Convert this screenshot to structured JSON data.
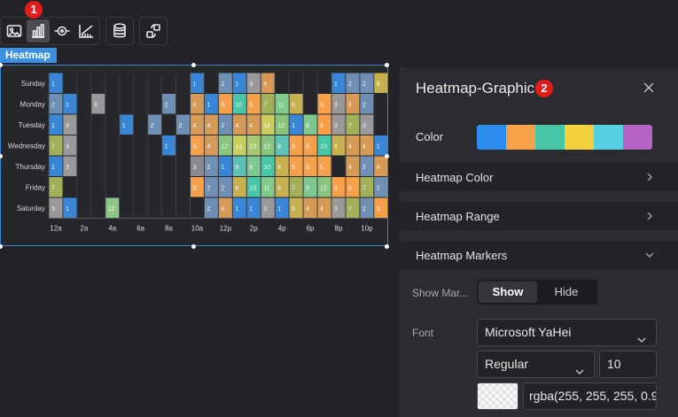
{
  "toolbar": {
    "buttons": [
      {
        "icon": "image-icon"
      },
      {
        "icon": "bar-chart-icon",
        "active": true
      },
      {
        "icon": "marker-icon"
      },
      {
        "icon": "axis-icon"
      },
      {
        "icon": "database-icon"
      },
      {
        "icon": "interaction-icon"
      }
    ],
    "badge_1": "1"
  },
  "widget_tag": "Heatmap",
  "panel": {
    "title": "Heatmap-Graphic",
    "badge_2": "2",
    "color_label": "Color",
    "palette": [
      "#2d8cf0",
      "#f9a24a",
      "#49c6a8",
      "#f4d03f",
      "#56cfe1",
      "#b564c6"
    ],
    "sections": {
      "heatmap_color": "Heatmap Color",
      "heatmap_range": "Heatmap Range",
      "heatmap_markers": "Heatmap Markers"
    },
    "show_markers_label": "Show Mar...",
    "show_label": "Show",
    "hide_label": "Hide",
    "font_label": "Font",
    "font_family": "Microsoft YaHei",
    "font_weight": "Regular",
    "font_size": "10",
    "font_color": "rgba(255, 255, 255, 0.9"
  },
  "chart_data": {
    "type": "heatmap",
    "y_categories": [
      "Sunday",
      "Monday",
      "Tuesday",
      "Wednesday",
      "Thursday",
      "Friday",
      "Saturday"
    ],
    "x_tick_labels": [
      "12a",
      "2a",
      "4a",
      "6a",
      "8a",
      "10a",
      "12p",
      "2p",
      "4p",
      "6p",
      "8p",
      "10p"
    ],
    "hours": 24,
    "cells": [
      [
        0,
        0,
        1
      ],
      [
        0,
        10,
        1
      ],
      [
        0,
        12,
        2
      ],
      [
        0,
        13,
        1
      ],
      [
        0,
        14,
        3
      ],
      [
        0,
        15,
        4
      ],
      [
        0,
        20,
        1
      ],
      [
        0,
        21,
        2
      ],
      [
        0,
        22,
        2
      ],
      [
        0,
        23,
        6
      ],
      [
        1,
        0,
        2
      ],
      [
        1,
        1,
        1
      ],
      [
        1,
        3,
        3
      ],
      [
        1,
        8,
        2
      ],
      [
        1,
        10,
        4
      ],
      [
        1,
        11,
        1
      ],
      [
        1,
        12,
        5
      ],
      [
        1,
        13,
        10
      ],
      [
        1,
        14,
        5
      ],
      [
        1,
        15,
        7
      ],
      [
        1,
        16,
        11
      ],
      [
        1,
        17,
        6
      ],
      [
        1,
        19,
        5
      ],
      [
        1,
        20,
        3
      ],
      [
        1,
        21,
        4
      ],
      [
        1,
        22,
        2
      ],
      [
        2,
        0,
        1
      ],
      [
        2,
        1,
        3
      ],
      [
        2,
        5,
        1
      ],
      [
        2,
        7,
        2
      ],
      [
        2,
        9,
        2
      ],
      [
        2,
        10,
        4
      ],
      [
        2,
        11,
        4
      ],
      [
        2,
        12,
        2
      ],
      [
        2,
        13,
        4
      ],
      [
        2,
        14,
        4
      ],
      [
        2,
        15,
        14
      ],
      [
        2,
        16,
        12
      ],
      [
        2,
        17,
        1
      ],
      [
        2,
        18,
        8
      ],
      [
        2,
        19,
        5
      ],
      [
        2,
        20,
        3
      ],
      [
        2,
        21,
        7
      ],
      [
        2,
        22,
        3
      ],
      [
        3,
        0,
        7
      ],
      [
        3,
        1,
        3
      ],
      [
        3,
        8,
        1
      ],
      [
        3,
        10,
        5
      ],
      [
        3,
        11,
        4
      ],
      [
        3,
        12,
        12
      ],
      [
        3,
        13,
        14
      ],
      [
        3,
        14,
        13
      ],
      [
        3,
        15,
        12
      ],
      [
        3,
        16,
        9
      ],
      [
        3,
        17,
        5
      ],
      [
        3,
        18,
        5
      ],
      [
        3,
        19,
        10
      ],
      [
        3,
        20,
        6
      ],
      [
        3,
        21,
        4
      ],
      [
        3,
        22,
        4
      ],
      [
        3,
        23,
        1
      ],
      [
        4,
        0,
        1
      ],
      [
        4,
        1,
        3
      ],
      [
        4,
        10,
        3
      ],
      [
        4,
        11,
        2
      ],
      [
        4,
        12,
        1
      ],
      [
        4,
        13,
        9
      ],
      [
        4,
        14,
        8
      ],
      [
        4,
        15,
        10
      ],
      [
        4,
        16,
        6
      ],
      [
        4,
        17,
        5
      ],
      [
        4,
        18,
        5
      ],
      [
        4,
        19,
        5
      ],
      [
        4,
        21,
        4
      ],
      [
        4,
        22,
        2
      ],
      [
        4,
        23,
        4
      ],
      [
        5,
        0,
        7
      ],
      [
        5,
        10,
        5
      ],
      [
        5,
        11,
        2
      ],
      [
        5,
        12,
        2
      ],
      [
        5,
        13,
        6
      ],
      [
        5,
        14,
        10
      ],
      [
        5,
        15,
        11
      ],
      [
        5,
        16,
        6
      ],
      [
        5,
        17,
        7
      ],
      [
        5,
        18,
        8
      ],
      [
        5,
        19,
        12
      ],
      [
        5,
        20,
        5
      ],
      [
        5,
        21,
        5
      ],
      [
        5,
        22,
        7
      ],
      [
        5,
        23,
        2
      ],
      [
        6,
        0,
        3
      ],
      [
        6,
        1,
        1
      ],
      [
        6,
        4,
        12
      ],
      [
        6,
        11,
        2
      ],
      [
        6,
        12,
        4
      ],
      [
        6,
        13,
        1
      ],
      [
        6,
        14,
        1
      ],
      [
        6,
        15,
        3
      ],
      [
        6,
        16,
        1
      ],
      [
        6,
        17,
        6
      ],
      [
        6,
        18,
        4
      ],
      [
        6,
        19,
        4
      ],
      [
        6,
        20,
        3
      ],
      [
        6,
        21,
        7
      ],
      [
        6,
        22,
        2
      ],
      [
        6,
        23,
        5
      ]
    ],
    "colors": {
      "1": "#3a86d6",
      "2": "#6f8fb4",
      "3": "#9a9898",
      "4": "#d59a55",
      "5": "#f6a04b",
      "6": "#c7b04f",
      "7": "#a2b05a",
      "8": "#7dc790",
      "9": "#5cc2b5",
      "10": "#49c6a8",
      "11": "#7ecb8c",
      "12": "#8ac57d",
      "13": "#a9c86e",
      "14": "#c8cd5e"
    },
    "overrides": {
      "4-20": "#1e1f24",
      "6-4": "#8dc785",
      "4-10": "#8b8a93"
    }
  }
}
